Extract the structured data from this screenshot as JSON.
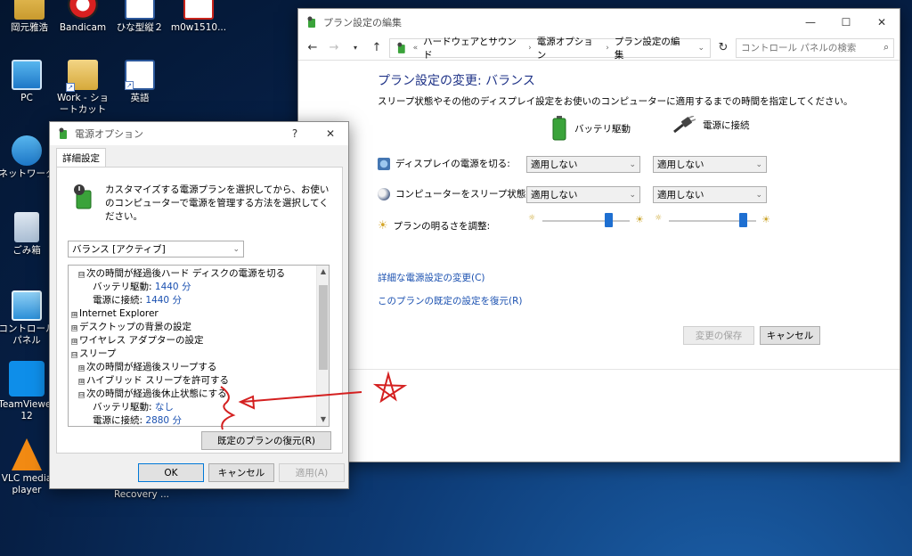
{
  "desktop": {
    "icons": [
      {
        "label": "岡元雅浩"
      },
      {
        "label": "Bandicam"
      },
      {
        "label": "ひな型縦２"
      },
      {
        "label": "m0w1510..."
      },
      {
        "label": "PC"
      },
      {
        "label": "Work - ショートカット"
      },
      {
        "label": "英語"
      },
      {
        "label": "ネットワーク"
      },
      {
        "label": "ごみ箱"
      },
      {
        "label": "コントロール パネル"
      },
      {
        "label": "TeamViewer 12"
      },
      {
        "label": "VLC media player"
      },
      {
        "label": "Recovery ..."
      }
    ]
  },
  "cp_window": {
    "title": "プラン設定の編集",
    "address": {
      "sep": "«",
      "crumbs": [
        "ハードウェアとサウンド",
        "電源オプション",
        "プラン設定の編集"
      ],
      "search_placeholder": "コントロール パネルの検索"
    },
    "heading": "プラン設定の変更: バランス",
    "description": "スリープ状態やその他のディスプレイ設定をお使いのコンピューターに適用するまでの時間を指定してください。",
    "col_battery": "バッテリ駆動",
    "col_plugged": "電源に接続",
    "rows": {
      "display_label": "ディスプレイの電源を切る:",
      "display_battery": "適用しない",
      "display_plugged": "適用しない",
      "sleep_label": "コンピューターをスリープ状態にする:",
      "sleep_battery": "適用しない",
      "sleep_plugged": "適用しない",
      "brightness_label": "プランの明るさを調整:",
      "brightness_battery": 0.75,
      "brightness_plugged": 0.85
    },
    "link_advanced": "詳細な電源設定の変更(C)",
    "link_restore": "このプランの既定の設定を復元(R)",
    "btn_save": "変更の保存",
    "btn_cancel": "キャンセル"
  },
  "po_dialog": {
    "title": "電源オプション",
    "help": "?",
    "tab": "詳細設定",
    "description": "カスタマイズする電源プランを選択してから、お使いのコンピューターで電源を管理する方法を選択してください。",
    "plan_select": "バランス [アクティブ]",
    "tree": [
      {
        "sign": "⊟",
        "text": "次の時間が経過後ハード ディスクの電源を切る",
        "indent": 1
      },
      {
        "text": "バッテリ駆動:",
        "value": "1440 分",
        "indent": 2
      },
      {
        "text": "電源に接続:",
        "value": "1440 分",
        "indent": 2
      },
      {
        "sign": "⊞",
        "text": "Internet Explorer",
        "indent": 0
      },
      {
        "sign": "⊞",
        "text": "デスクトップの背景の設定",
        "indent": 0
      },
      {
        "sign": "⊞",
        "text": "ワイヤレス アダプターの設定",
        "indent": 0
      },
      {
        "sign": "⊟",
        "text": "スリープ",
        "indent": 0
      },
      {
        "sign": "⊞",
        "text": "次の時間が経過後スリープする",
        "indent": 1
      },
      {
        "sign": "⊞",
        "text": "ハイブリッド スリープを許可する",
        "indent": 1
      },
      {
        "sign": "⊟",
        "text": "次の時間が経過後休止状態にする",
        "indent": 1
      },
      {
        "text": "バッテリ駆動:",
        "value": "なし",
        "indent": 2
      },
      {
        "text": "電源に接続:",
        "value": "2880 分",
        "indent": 2
      }
    ],
    "btn_restore": "既定のプランの復元(R)",
    "btn_ok": "OK",
    "btn_cancel": "キャンセル",
    "btn_apply": "適用(A)"
  },
  "colors": {
    "link": "#1a50b0",
    "heading": "#1e3287",
    "annotation": "#d42020"
  }
}
